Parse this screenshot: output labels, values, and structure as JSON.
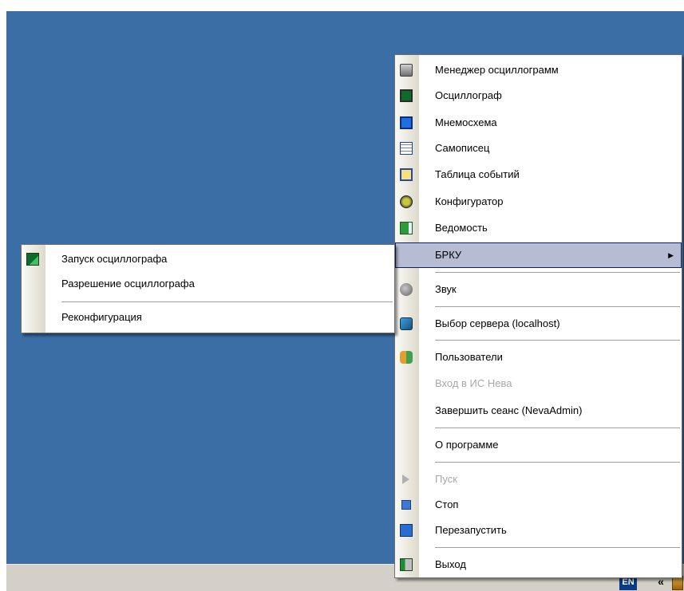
{
  "main_menu": {
    "items": [
      {
        "label": "Менеджер осциллограмм",
        "icon": "oscillogram-manager-icon"
      },
      {
        "label": "Осциллограф",
        "icon": "oscilloscope-icon"
      },
      {
        "label": "Мнемосхема",
        "icon": "mimic-diagram-icon"
      },
      {
        "label": "Самописец",
        "icon": "chart-recorder-icon"
      },
      {
        "label": "Таблица событий",
        "icon": "event-table-icon"
      },
      {
        "label": "Конфигуратор",
        "icon": "configurator-icon"
      },
      {
        "label": "Ведомость",
        "icon": "report-icon"
      },
      {
        "label": "БРКУ",
        "highlighted": true,
        "has_submenu": true
      },
      {
        "label": "Звук",
        "icon": "sound-icon"
      },
      {
        "label": "Выбор сервера (localhost)",
        "icon": "server-select-icon"
      },
      {
        "label": "Пользователи",
        "icon": "users-icon"
      },
      {
        "label": "Вход в ИС Нева",
        "disabled": true
      },
      {
        "label": "Завершить сеанс (NevaAdmin)"
      },
      {
        "label": "О программе"
      },
      {
        "label": "Пуск",
        "icon": "play-icon",
        "disabled": true
      },
      {
        "label": "Стоп",
        "icon": "stop-icon"
      },
      {
        "label": "Перезапустить",
        "icon": "restart-icon"
      },
      {
        "label": "Выход",
        "icon": "exit-icon"
      }
    ]
  },
  "submenu": {
    "items": [
      {
        "label": "Запуск осциллографа",
        "icon": "launch-oscilloscope-icon"
      },
      {
        "label": "Разрешение осциллографа"
      },
      {
        "label": "Реконфигурация"
      }
    ]
  },
  "taskbar": {
    "language": "EN",
    "chevron": "«"
  },
  "colors": {
    "desktop": "#3a6ea5",
    "highlight": "#b6bdd2",
    "highlight_border": "#0a246a",
    "disabled_text": "#a7a7a7"
  }
}
